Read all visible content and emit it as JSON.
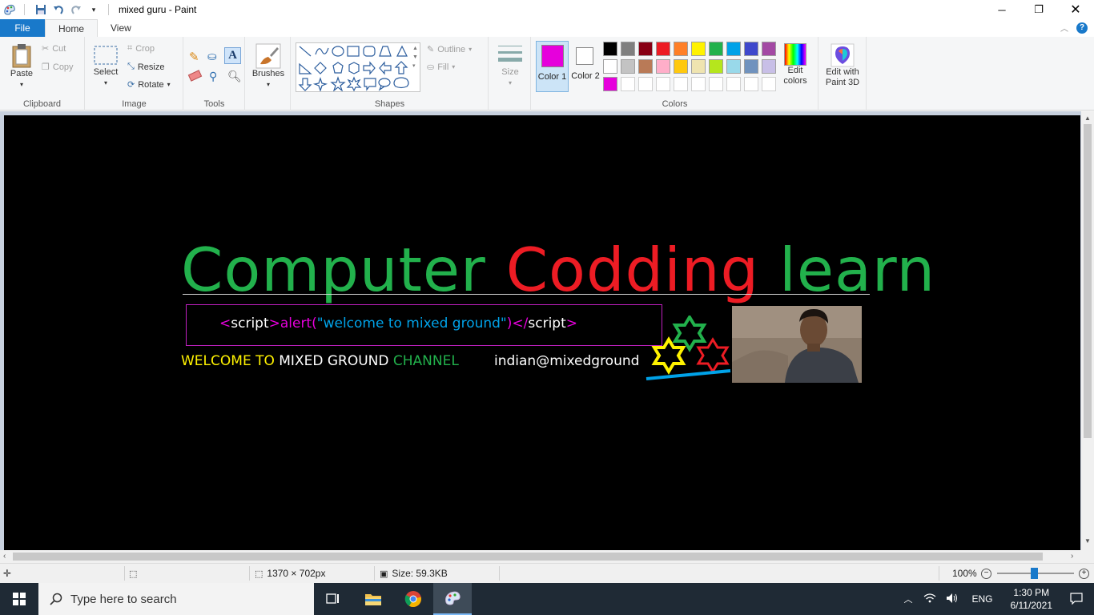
{
  "window": {
    "title": "mixed guru - Paint"
  },
  "tabs": [
    {
      "label": "File"
    },
    {
      "label": "Home"
    },
    {
      "label": "View"
    }
  ],
  "ribbon": {
    "clipboard": {
      "paste": "Paste",
      "cut": "Cut",
      "copy": "Copy",
      "group": "Clipboard"
    },
    "image": {
      "select": "Select",
      "crop": "Crop",
      "resize": "Resize",
      "rotate": "Rotate",
      "group": "Image"
    },
    "tools": {
      "group": "Tools"
    },
    "brushes": {
      "label": "Brushes"
    },
    "shapes": {
      "outline": "Outline",
      "fill": "Fill",
      "group": "Shapes"
    },
    "size": {
      "label": "Size"
    },
    "colors": {
      "color1": "Color 1",
      "color2": "Color 2",
      "edit_colors": "Edit colors",
      "edit_paint3d": "Edit with Paint 3D",
      "group": "Colors",
      "color1_value": "#e600dc",
      "color2_value": "#ffffff",
      "palette_row1": [
        "#000000",
        "#7f7f7f",
        "#880015",
        "#ed1c24",
        "#ff7f27",
        "#fff200",
        "#22b14c",
        "#00a2e8",
        "#3f48cc",
        "#a349a4"
      ],
      "palette_row2": [
        "#ffffff",
        "#c3c3c3",
        "#b97a57",
        "#ffaec9",
        "#ffc90e",
        "#efe4b0",
        "#b5e61d",
        "#99d9ea",
        "#7092be",
        "#c8bfe7"
      ],
      "palette_row3": [
        "#e600dc",
        "#ffffff",
        "#ffffff",
        "#ffffff",
        "#ffffff",
        "#ffffff",
        "#ffffff",
        "#ffffff",
        "#ffffff",
        "#ffffff"
      ]
    }
  },
  "canvas": {
    "headline_word1": "Computer",
    "headline_word2": "Codding",
    "headline_word3": "learn",
    "headline_colors": {
      "green": "#22b14c",
      "red": "#ed1c24"
    },
    "code_open_lt": "<",
    "code_tag1": "script",
    "code_gt1": ">",
    "code_alert": "alert(",
    "code_string": "\"welcome to mixed ground\"",
    "code_close_paren": ")",
    "code_close_lt": "</",
    "code_tag2": "script",
    "code_gt2": ">",
    "welcome_part1": "WELCOME TO",
    "welcome_part2": "MIXED GROUND",
    "welcome_part3": "CHANNEL",
    "email": "indian@mixedground"
  },
  "status": {
    "dimensions": "1370 × 702px",
    "size": "Size: 59.3KB",
    "zoom": "100%"
  },
  "taskbar": {
    "search_placeholder": "Type here to search",
    "lang": "ENG",
    "time": "1:30 PM",
    "date": "6/11/2021"
  }
}
